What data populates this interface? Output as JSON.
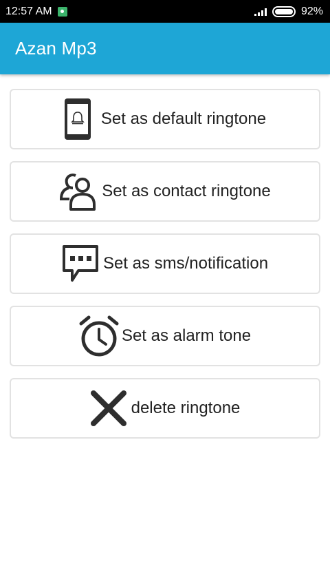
{
  "status_bar": {
    "time": "12:57 AM",
    "battery": "92%"
  },
  "app_bar": {
    "title": "Azan Mp3"
  },
  "actions": [
    {
      "label": "Set as default ringtone",
      "icon": "phone-bell-icon"
    },
    {
      "label": "Set as contact ringtone",
      "icon": "contact-icon"
    },
    {
      "label": "Set as sms/notification",
      "icon": "message-icon"
    },
    {
      "label": "Set as alarm tone",
      "icon": "alarm-clock-icon"
    },
    {
      "label": "delete ringtone",
      "icon": "close-icon"
    }
  ],
  "colors": {
    "app_bar": "#1ea6d6",
    "status_bar": "#000000",
    "icon": "#2e2e2e",
    "card_border": "#e2e2e2"
  }
}
